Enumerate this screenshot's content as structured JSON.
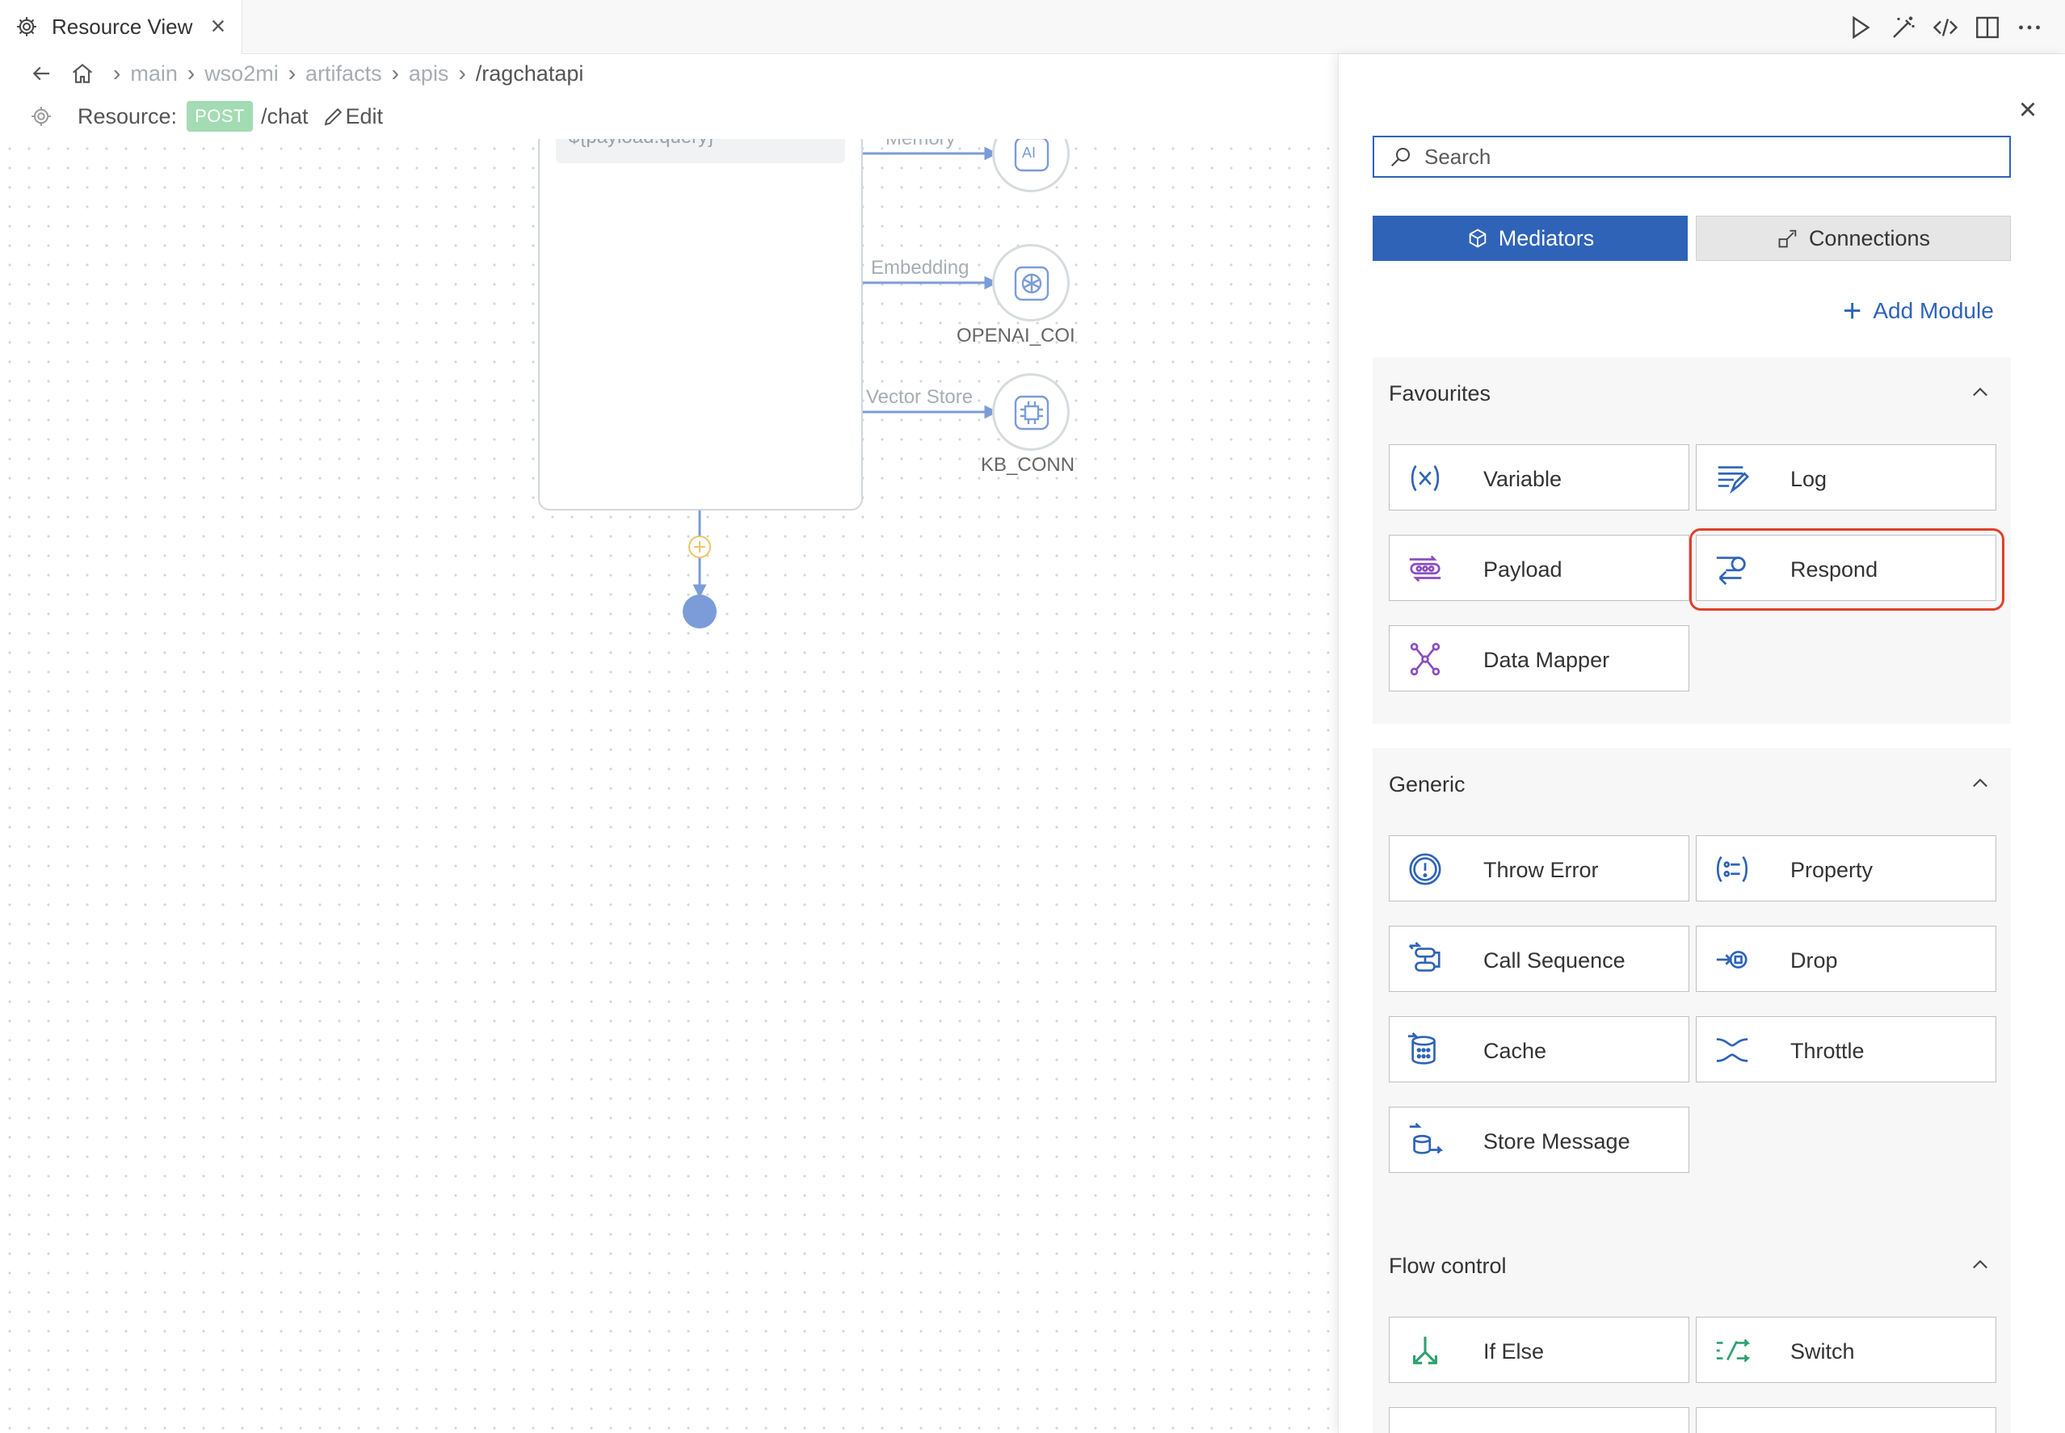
{
  "tab": {
    "title": "Resource View",
    "close": "×"
  },
  "breadcrumb": [
    "main",
    "wso2mi",
    "artifacts",
    "apis",
    "/ragchatapi"
  ],
  "resource": {
    "label": "Resource:",
    "method": "POST",
    "path": "/chat",
    "edit": "Edit"
  },
  "canvas": {
    "node_expr": "${payload.query}",
    "edges": [
      "Memory",
      "Embedding",
      "Vector Store"
    ],
    "connections": [
      {
        "name": "",
        "icon": "ai-icon"
      },
      {
        "name": "OPENAI_COI",
        "icon": "openai-icon"
      },
      {
        "name": "KB_CONN",
        "icon": "chip-icon"
      }
    ]
  },
  "panel": {
    "search_placeholder": "Search",
    "tabs": {
      "mediators": "Mediators",
      "connections": "Connections"
    },
    "add_module": "Add Module",
    "sections": [
      {
        "title": "Favourites",
        "items": [
          "Variable",
          "Log",
          "Payload",
          "Respond",
          "Data Mapper"
        ]
      },
      {
        "title": "Generic",
        "items": [
          "Throw Error",
          "Property",
          "Call Sequence",
          "Drop",
          "Cache",
          "Throttle",
          "Store Message"
        ]
      },
      {
        "title": "Flow control",
        "items": [
          "If Else",
          "Switch"
        ]
      }
    ]
  },
  "colors": {
    "accent": "#2e63b8",
    "highlight": "#e0402a",
    "post_badge": "#a3dbb3",
    "end_node": "#7b9cd8"
  }
}
